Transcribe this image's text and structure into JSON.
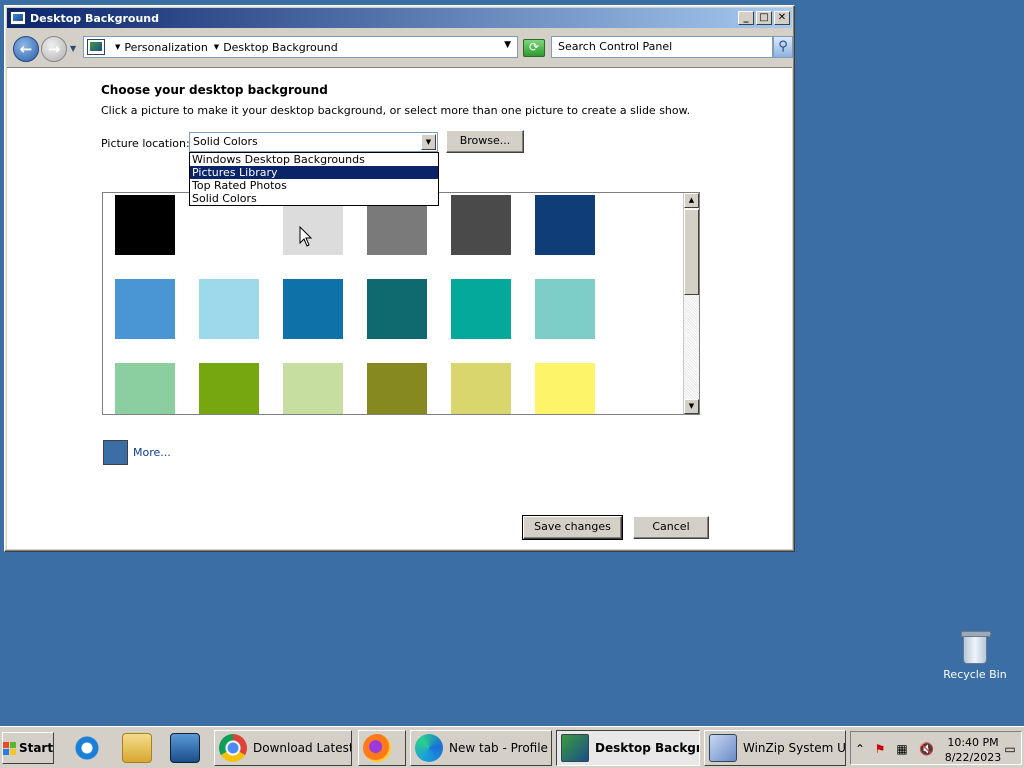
{
  "window": {
    "title": "Desktop Background",
    "minimize_label": "_",
    "maximize_label": "□",
    "close_label": "✕"
  },
  "address_bar": {
    "back_label": "←",
    "forward_label": "→",
    "breadcrumbs": [
      "Personalization",
      "Desktop Background"
    ],
    "search_placeholder": "Search Control Panel"
  },
  "content": {
    "heading": "Choose your desktop background",
    "subtext": "Click a picture to make it your desktop background, or select more than one picture to create a slide show.",
    "picture_location_label": "Picture location:",
    "picture_location_value": "Solid Colors",
    "browse_label": "Browse...",
    "dropdown_options": [
      "Windows Desktop Backgrounds",
      "Pictures Library",
      "Top Rated Photos",
      "Solid Colors"
    ],
    "dropdown_highlighted": "Pictures Library",
    "swatch_colors": [
      [
        "#000000",
        "#ffffff",
        "#dcdcdc",
        "#7a7a7a",
        "#4a4a4a",
        "#0f3d78"
      ],
      [
        "#4a96d4",
        "#9cd9ea",
        "#0e72a8",
        "#0e6a6e",
        "#04a99c",
        "#7dcdc8"
      ],
      [
        "#8bcea0",
        "#76a70e",
        "#c6dfa0",
        "#868920",
        "#d9d66e",
        "#fdf46a"
      ]
    ],
    "more_swatch_color": "#3a6ea5",
    "more_label": "More...",
    "save_label": "Save changes",
    "cancel_label": "Cancel"
  },
  "desktop": {
    "background_color": "#3a6ea5",
    "recycle_bin_label": "Recycle Bin"
  },
  "taskbar": {
    "start_label": "Start",
    "tasks": [
      {
        "label": "Download Latest ...",
        "icon": "chrome-icon",
        "active": false
      },
      {
        "label": "",
        "icon": "firefox-icon",
        "active": false
      },
      {
        "label": "New tab - Profile ...",
        "icon": "edge-icon",
        "active": false
      },
      {
        "label": "Desktop Backgr...",
        "icon": "control-panel-icon",
        "active": true
      },
      {
        "label": "WinZip System Util...",
        "icon": "winzip-icon",
        "active": false
      }
    ],
    "clock_time": "10:40 PM",
    "clock_date": "8/22/2023"
  }
}
